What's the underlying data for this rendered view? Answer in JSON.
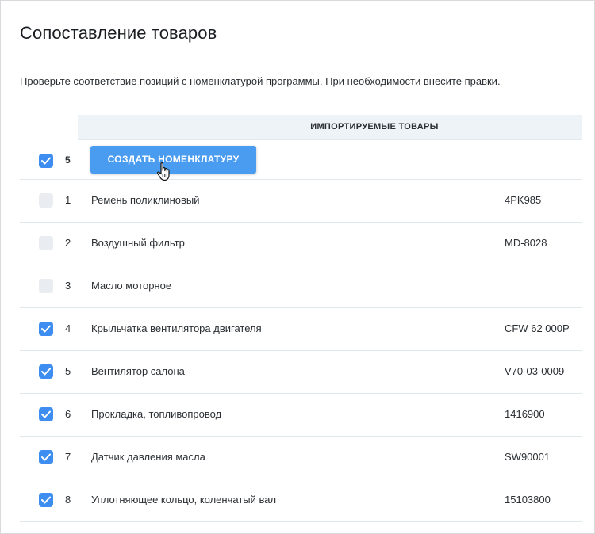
{
  "dialog": {
    "title": "Сопоставление товаров",
    "subtitle": "Проверьте соответствие позиций с номенклатурой программы. При необходимости внесите правки."
  },
  "table": {
    "column_header": "ИМПОРТИРУЕМЫЕ ТОВАРЫ",
    "selected_count": "5",
    "select_all_checked": true,
    "create_button_label": "СОЗДАТЬ НОМЕНКЛАТУРУ",
    "rows": [
      {
        "num": "1",
        "name": "Ремень поликлиновый",
        "code": "4PK985",
        "checked": false
      },
      {
        "num": "2",
        "name": "Воздушный фильтр",
        "code": "MD-8028",
        "checked": false
      },
      {
        "num": "3",
        "name": "Масло моторное",
        "code": "",
        "checked": false
      },
      {
        "num": "4",
        "name": "Крыльчатка вентилятора двигателя",
        "code": "CFW 62 000P",
        "checked": true
      },
      {
        "num": "5",
        "name": "Вентилятор салона",
        "code": "V70-03-0009",
        "checked": true
      },
      {
        "num": "6",
        "name": "Прокладка, топливопровод",
        "code": "1416900",
        "checked": true
      },
      {
        "num": "7",
        "name": "Датчик давления масла",
        "code": "SW90001",
        "checked": true
      },
      {
        "num": "8",
        "name": "Уплотняющее кольцо, коленчатый вал",
        "code": "15103800",
        "checked": true
      }
    ]
  },
  "colors": {
    "accent": "#3d8ef0",
    "button": "#4a9cf0",
    "header_bg": "#eef3f8"
  }
}
